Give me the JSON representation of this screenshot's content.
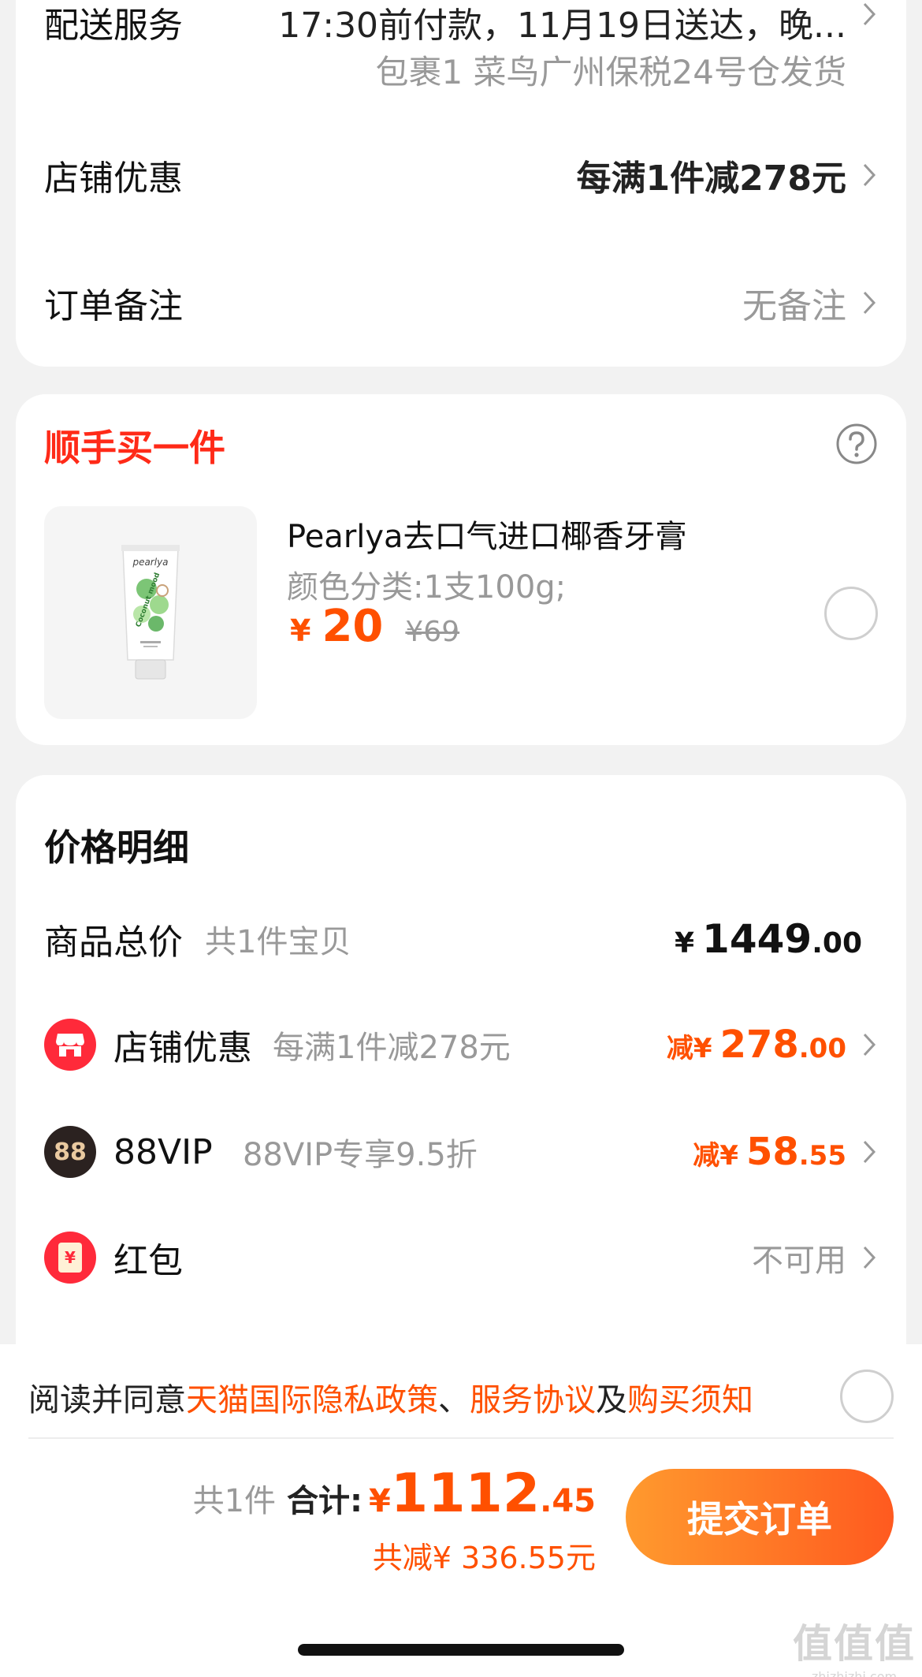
{
  "delivery": {
    "label": "配送服务",
    "value": "17:30前付款，11月19日送达，晚...",
    "subvalue": "包裹1 菜鸟广州保税24号仓发货"
  },
  "shop_discount_row": {
    "label": "店铺优惠",
    "value": "每满1件减278元"
  },
  "order_note": {
    "label": "订单备注",
    "value": "无备注"
  },
  "addon": {
    "title": "顺手买一件",
    "help_icon": "question-circle-icon",
    "product": {
      "name": "Pearlya去口气进口椰香牙膏",
      "variant": "颜色分类:1支100g;",
      "price_symbol": "¥",
      "price": "20",
      "original_price": "¥69",
      "image_brand": "pearlya",
      "image_text": "Coconut mood"
    }
  },
  "price_detail": {
    "title": "价格明细",
    "total": {
      "label": "商品总价",
      "sub": "共1件宝贝",
      "symbol": "¥",
      "int": "1449",
      "dec": ".00"
    },
    "shop": {
      "icon": "shop-icon",
      "label": "店铺优惠",
      "sub": "每满1件减278元",
      "prefix": "减¥",
      "int": "278",
      "dec": ".00"
    },
    "vip": {
      "icon": "88vip-icon",
      "icon_text": "88",
      "label": "88VIP",
      "sub": "88VIP专享9.5折",
      "prefix": "减¥",
      "int": "58",
      "dec": ".55"
    },
    "redpacket": {
      "icon": "red-packet-icon",
      "icon_text": "¥",
      "label": "红包",
      "value": "不可用"
    }
  },
  "agreement": {
    "prefix": "阅读并同意",
    "link1": "天猫国际隐私政策",
    "sep1": "、",
    "link2": "服务协议",
    "sep2": "及",
    "link3": "购买须知"
  },
  "checkout": {
    "count": "共1件",
    "total_label": "合计:",
    "symbol": "¥",
    "int": "1112",
    "dec": ".45",
    "saved": "共减¥ 336.55元",
    "submit": "提交订单"
  },
  "watermark": {
    "text": "值值值",
    "sub": "zhizhizhi.com"
  },
  "colors": {
    "accent": "#ff5000",
    "title_red": "#ff2a18",
    "button_start": "#ff9a2e",
    "button_end": "#ff5a1f"
  }
}
